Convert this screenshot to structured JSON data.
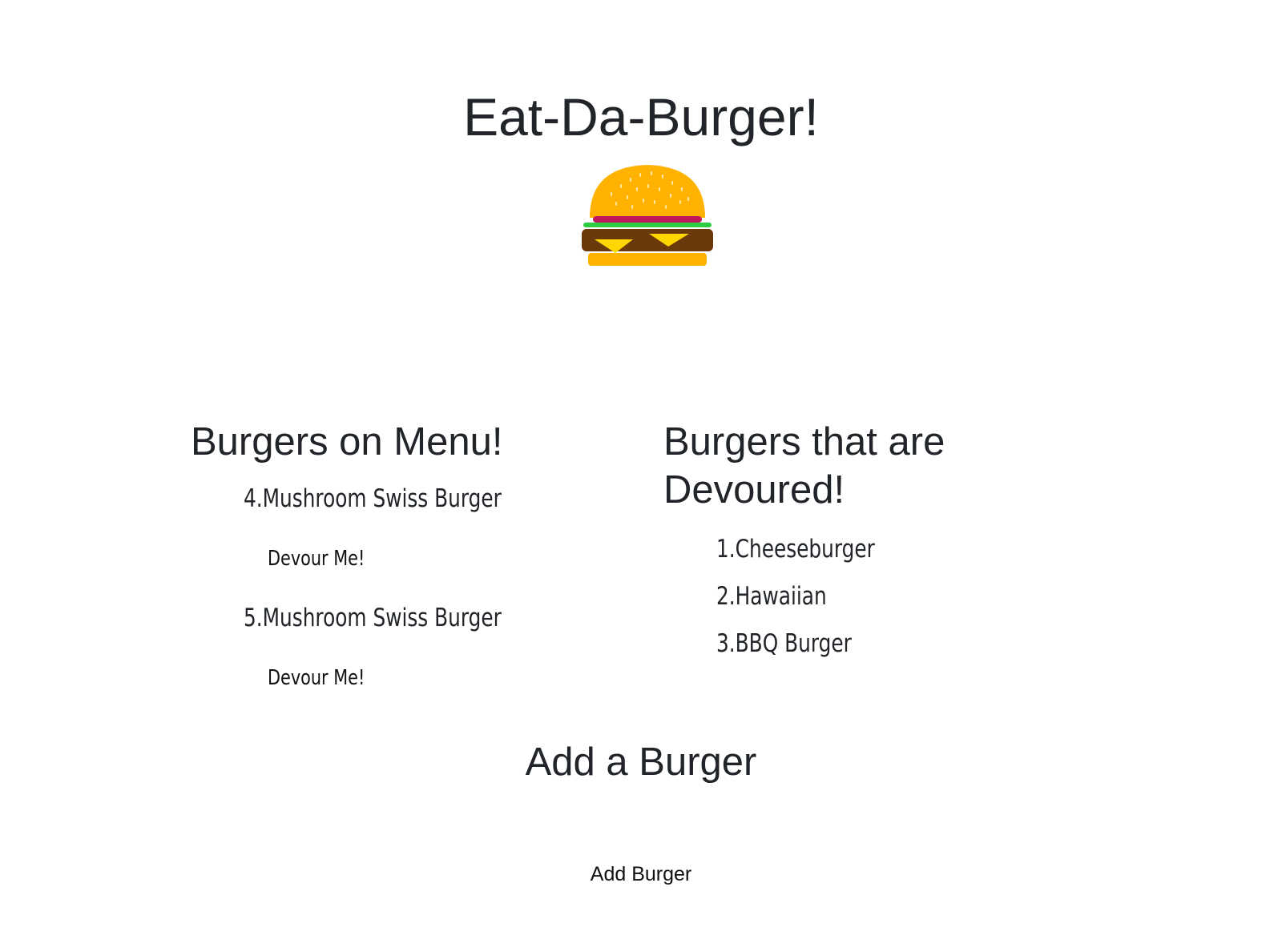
{
  "header": {
    "title": "Eat-Da-Burger!",
    "logo_icon": "hamburger-icon"
  },
  "menu": {
    "heading": "Burgers on Menu!",
    "items": [
      {
        "label": "4.Mushroom Swiss Burger",
        "button_label": "Devour Me!"
      },
      {
        "label": "5.Mushroom Swiss Burger",
        "button_label": "Devour Me!"
      }
    ]
  },
  "devoured": {
    "heading": "Burgers that are Devoured!",
    "items": [
      {
        "label": "1.Cheeseburger"
      },
      {
        "label": "2.Hawaiian"
      },
      {
        "label": "3.BBQ Burger"
      }
    ]
  },
  "add_form": {
    "heading": "Add a Burger",
    "input_value": "",
    "button_label": "Add Burger"
  },
  "colors": {
    "text": "#212529",
    "bun": "#FFB300",
    "patty": "#6B3A0C",
    "cheese": "#FFD600",
    "lettuce": "#2ECC40",
    "tomato": "#C2185B"
  }
}
